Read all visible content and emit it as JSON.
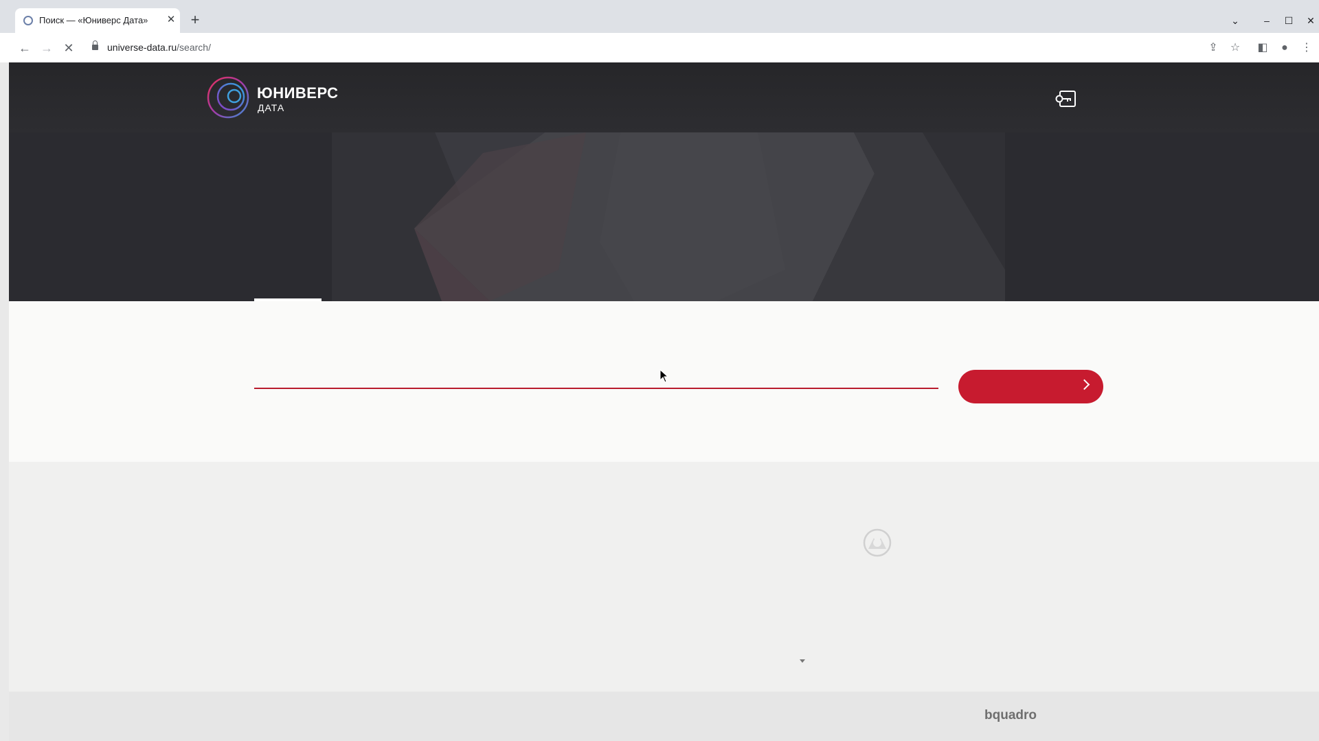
{
  "browser": {
    "tab": {
      "title": "Поиск — «Юниверс Дата»"
    },
    "url": {
      "domain": "universe-data.ru",
      "path": "/search/"
    },
    "icons": [
      "back-icon",
      "forward-icon",
      "stop-loading-icon",
      "lock-icon",
      "share-icon",
      "star-icon",
      "side-panel-icon",
      "profile-icon",
      "menu-icon",
      "chevron-down-icon",
      "minimize-icon",
      "maximize-icon",
      "close-icon",
      "new-tab-icon"
    ]
  },
  "site": {
    "logo": {
      "title": "ЮНИВЕРС",
      "subtitle": "ДАТА"
    },
    "search": {
      "placeholder": "",
      "value": ""
    },
    "footer": {
      "brand": "bquadro"
    },
    "colors": {
      "accent": "#c71b2f",
      "header": "#2b2b30",
      "footer": "#e6e6e6"
    }
  }
}
